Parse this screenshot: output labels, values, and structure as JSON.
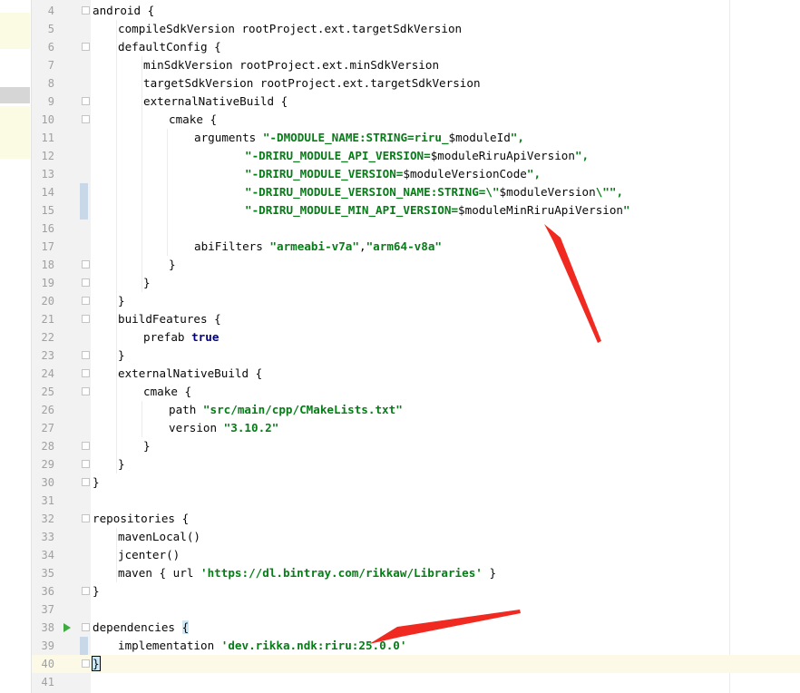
{
  "editor": {
    "current_line": 40,
    "lines": [
      {
        "n": "4",
        "indent": 0,
        "segs": [
          {
            "t": "android {"
          }
        ]
      },
      {
        "n": "5",
        "indent": 1,
        "segs": [
          {
            "t": "compileSdkVersion rootProject.ext.targetSdkVersion"
          }
        ]
      },
      {
        "n": "6",
        "indent": 1,
        "segs": [
          {
            "t": "defaultConfig {"
          }
        ]
      },
      {
        "n": "7",
        "indent": 2,
        "segs": [
          {
            "t": "minSdkVersion rootProject.ext.minSdkVersion"
          }
        ]
      },
      {
        "n": "8",
        "indent": 2,
        "segs": [
          {
            "t": "targetSdkVersion rootProject.ext.targetSdkVersion"
          }
        ]
      },
      {
        "n": "9",
        "indent": 2,
        "segs": [
          {
            "t": "externalNativeBuild {"
          }
        ]
      },
      {
        "n": "10",
        "indent": 3,
        "segs": [
          {
            "t": "cmake {"
          }
        ]
      },
      {
        "n": "11",
        "indent": 4,
        "segs": [
          {
            "t": "arguments "
          },
          {
            "t": "\"-DMODULE_NAME:STRING=riru_",
            "c": "s"
          },
          {
            "t": "$moduleId"
          },
          {
            "t": "\",",
            "c": "s"
          }
        ]
      },
      {
        "n": "12",
        "indent": 6,
        "segs": [
          {
            "t": "\"-DRIRU_MODULE_API_VERSION=",
            "c": "s"
          },
          {
            "t": "$moduleRiruApiVersion"
          },
          {
            "t": "\",",
            "c": "s"
          }
        ]
      },
      {
        "n": "13",
        "indent": 6,
        "segs": [
          {
            "t": "\"-DRIRU_MODULE_VERSION=",
            "c": "s"
          },
          {
            "t": "$moduleVersionCode"
          },
          {
            "t": "\",",
            "c": "s"
          }
        ]
      },
      {
        "n": "14",
        "indent": 6,
        "segs": [
          {
            "t": "\"-DRIRU_MODULE_VERSION_NAME:STRING=\\\"",
            "c": "s"
          },
          {
            "t": "$moduleVersion"
          },
          {
            "t": "\\\"\",",
            "c": "s"
          }
        ]
      },
      {
        "n": "15",
        "indent": 6,
        "segs": [
          {
            "t": "\"-DRIRU_MODULE_MIN_API_VERSION=",
            "c": "s"
          },
          {
            "t": "$moduleMinRiruApiVersion"
          },
          {
            "t": "\"",
            "c": "s"
          }
        ]
      },
      {
        "n": "16",
        "indent": 0,
        "segs": []
      },
      {
        "n": "17",
        "indent": 4,
        "segs": [
          {
            "t": "abiFilters "
          },
          {
            "t": "\"armeabi-v7a\"",
            "c": "s"
          },
          {
            "t": ","
          },
          {
            "t": "\"arm64-v8a\"",
            "c": "s"
          }
        ]
      },
      {
        "n": "18",
        "indent": 3,
        "segs": [
          {
            "t": "}"
          }
        ]
      },
      {
        "n": "19",
        "indent": 2,
        "segs": [
          {
            "t": "}"
          }
        ]
      },
      {
        "n": "20",
        "indent": 1,
        "segs": [
          {
            "t": "}"
          }
        ]
      },
      {
        "n": "21",
        "indent": 1,
        "segs": [
          {
            "t": "buildFeatures {"
          }
        ]
      },
      {
        "n": "22",
        "indent": 2,
        "segs": [
          {
            "t": "prefab "
          },
          {
            "t": "true",
            "c": "k"
          }
        ]
      },
      {
        "n": "23",
        "indent": 1,
        "segs": [
          {
            "t": "}"
          }
        ]
      },
      {
        "n": "24",
        "indent": 1,
        "segs": [
          {
            "t": "externalNativeBuild {"
          }
        ]
      },
      {
        "n": "25",
        "indent": 2,
        "segs": [
          {
            "t": "cmake {"
          }
        ]
      },
      {
        "n": "26",
        "indent": 3,
        "segs": [
          {
            "t": "path "
          },
          {
            "t": "\"src/main/cpp/CMakeLists.txt\"",
            "c": "s"
          }
        ]
      },
      {
        "n": "27",
        "indent": 3,
        "segs": [
          {
            "t": "version "
          },
          {
            "t": "\"3.10.2\"",
            "c": "s"
          }
        ]
      },
      {
        "n": "28",
        "indent": 2,
        "segs": [
          {
            "t": "}"
          }
        ]
      },
      {
        "n": "29",
        "indent": 1,
        "segs": [
          {
            "t": "}"
          }
        ]
      },
      {
        "n": "30",
        "indent": 0,
        "segs": [
          {
            "t": "}"
          }
        ]
      },
      {
        "n": "31",
        "indent": 0,
        "segs": []
      },
      {
        "n": "32",
        "indent": 0,
        "segs": [
          {
            "t": "repositories {"
          }
        ]
      },
      {
        "n": "33",
        "indent": 1,
        "segs": [
          {
            "t": "mavenLocal()"
          }
        ]
      },
      {
        "n": "34",
        "indent": 1,
        "segs": [
          {
            "t": "jcenter()"
          }
        ]
      },
      {
        "n": "35",
        "indent": 1,
        "segs": [
          {
            "t": "maven { url "
          },
          {
            "t": "'https://dl.bintray.com/rikkaw/Libraries'",
            "c": "s"
          },
          {
            "t": " }"
          }
        ]
      },
      {
        "n": "36",
        "indent": 0,
        "segs": [
          {
            "t": "}"
          }
        ]
      },
      {
        "n": "37",
        "indent": 0,
        "segs": []
      },
      {
        "n": "38",
        "indent": 0,
        "segs": [
          {
            "t": "dependencies "
          },
          {
            "t": "{",
            "c": "hl"
          }
        ]
      },
      {
        "n": "39",
        "indent": 1,
        "segs": [
          {
            "t": "implementation "
          },
          {
            "t": "'dev.rikka.ndk:riru:25.0.0'",
            "c": "s"
          }
        ]
      },
      {
        "n": "40",
        "indent": 0,
        "segs": [
          {
            "t": "}",
            "c": "caret"
          }
        ]
      },
      {
        "n": "41",
        "indent": 0,
        "segs": []
      }
    ]
  },
  "gutter": {
    "run_icon": "run-triangle-icon",
    "run_icon_line": 38,
    "fold_lines": [
      4,
      6,
      9,
      10,
      18,
      19,
      20,
      21,
      23,
      24,
      25,
      28,
      29,
      30,
      32,
      36,
      38,
      40
    ],
    "changed_lines": [
      14,
      15,
      39
    ]
  },
  "annotations": [
    {
      "name": "red-arrow-upper",
      "color": "#f02a20"
    },
    {
      "name": "red-arrow-lower",
      "color": "#f02a20"
    }
  ]
}
